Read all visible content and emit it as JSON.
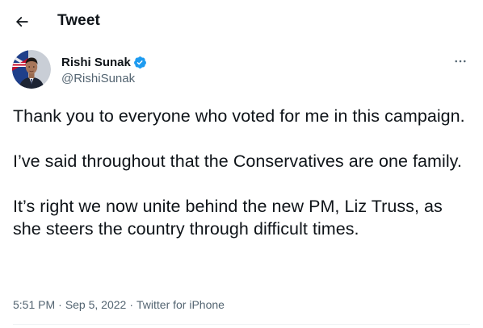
{
  "header": {
    "title": "Tweet",
    "back_icon": "arrow-left-icon"
  },
  "author": {
    "display_name": "Rishi Sunak",
    "handle": "@RishiSunak",
    "verified": true,
    "verified_color": "#1d9bf0",
    "avatar_icon": "avatar-photo",
    "more_icon": "more-horizontal-icon"
  },
  "tweet": {
    "paragraphs": [
      "Thank you to everyone who voted for me in this campaign.",
      "I’ve said throughout that the Conservatives are one family.",
      "It’s right we now unite behind the new PM, Liz Truss, as she steers the country through difficult times."
    ]
  },
  "meta": {
    "time": "5:51 PM",
    "date": "Sep 5, 2022",
    "separator": "·",
    "source": "Twitter for iPhone"
  },
  "colors": {
    "text_primary": "#0f1419",
    "text_secondary": "#536471",
    "accent": "#1d9bf0",
    "divider": "#eff3f4"
  }
}
